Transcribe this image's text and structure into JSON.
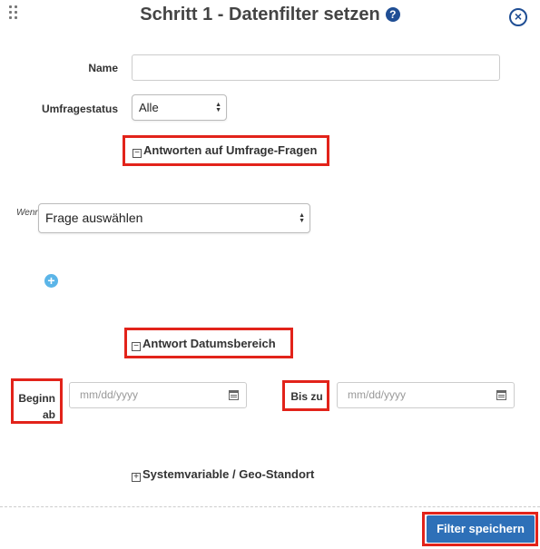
{
  "header": {
    "title": "Schritt 1 - Datenfilter setzen",
    "help_icon": "question-circle-icon",
    "close_icon": "close-circle-icon",
    "drag_icon": "drag-handle-icon",
    "help_glyph": "?",
    "close_glyph": "×"
  },
  "form": {
    "name_label": "Name",
    "name_value": "",
    "status_label": "Umfragestatus",
    "status_value": "Alle"
  },
  "sections": {
    "answers": {
      "label": "Antworten auf Umfrage-Fragen",
      "toggle": "−",
      "expanded": true
    },
    "date_range": {
      "label": "Antwort Datumsbereich",
      "toggle": "−",
      "expanded": true
    },
    "system": {
      "label": "Systemvariable / Geo-Standort",
      "toggle": "+",
      "expanded": false
    }
  },
  "condition": {
    "wenn_label": "Wenn",
    "question_select": "Frage auswählen",
    "add_glyph": "+"
  },
  "date_range": {
    "start_label_line1": "Beginn",
    "start_label_line2": "ab",
    "start_placeholder": "mm/dd/yyyy",
    "end_label": "Bis zu",
    "end_placeholder": "mm/dd/yyyy"
  },
  "footer": {
    "save_label": "Filter speichern"
  },
  "colors": {
    "accent": "#1f4e94",
    "button": "#2e70b8",
    "highlight": "#e2231a",
    "add": "#5bb5e8"
  }
}
